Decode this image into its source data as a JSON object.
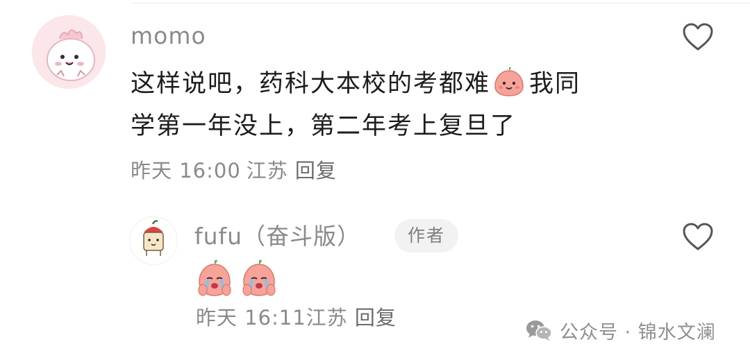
{
  "main_comment": {
    "username": "momo",
    "line1_before_emoji": "这样说吧，药科大本校的考都难",
    "line1_after_emoji": "我同",
    "line2": "学第一年没上，第二年考上复旦了",
    "inline_emoji": "smiling-peach-emoji",
    "time": "昨天 16:00",
    "location": "江苏",
    "reply_label": "回复"
  },
  "reply_comment": {
    "username": "fufu（奋斗版）",
    "badge": "作者",
    "emojis": [
      "crying-peach-emoji",
      "crying-peach-emoji"
    ],
    "time": "昨天 16:11",
    "location": "江苏",
    "reply_label": "回复"
  },
  "watermark": {
    "text": "公众号 · 锦水文澜",
    "icon": "wechat-icon"
  },
  "colors": {
    "meta_gray": "#8a8a8a",
    "badge_bg": "#f2f2f2",
    "avatar_pink": "#fbe6ea",
    "peach": "#f7a39a"
  }
}
